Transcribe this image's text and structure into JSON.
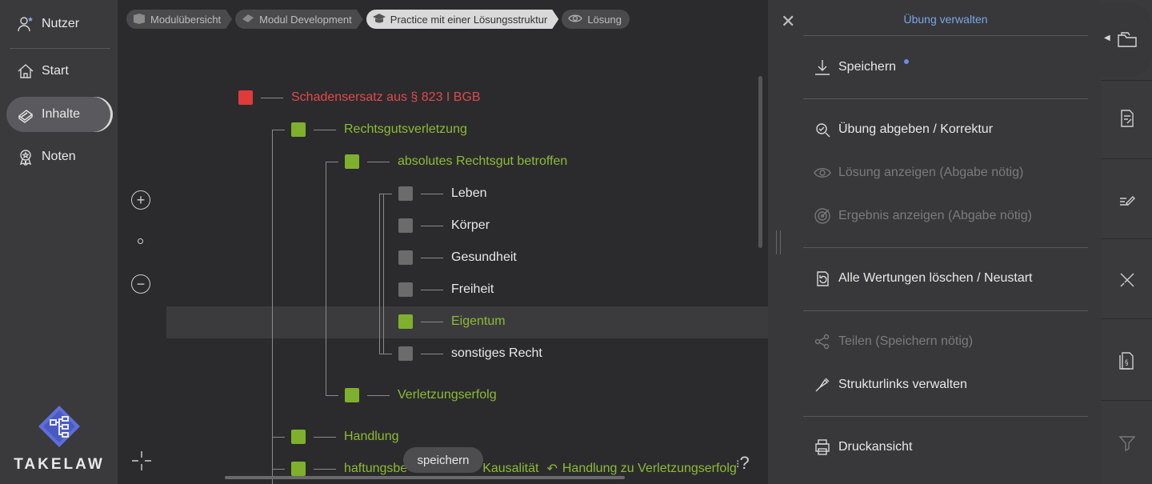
{
  "sidebar": {
    "items": [
      {
        "label": "Nutzer",
        "icon": "user-star-icon"
      },
      {
        "label": "Start",
        "icon": "home-icon"
      },
      {
        "label": "Inhalte",
        "icon": "book-icon"
      },
      {
        "label": "Noten",
        "icon": "award-icon"
      }
    ],
    "logo_text": "TAKELAW"
  },
  "breadcrumb": [
    {
      "label": "Modulübersicht",
      "icon": "box-icon"
    },
    {
      "label": "Modul Development",
      "icon": "book-icon"
    },
    {
      "label": "Practice mit einer Lösungsstruktur",
      "icon": "graduation-cap-icon"
    },
    {
      "label": "Lösung",
      "icon": "eye-icon"
    }
  ],
  "tree": {
    "root": "Schadensersatz aus § 823 I BGB",
    "rechtsgut": "Rechtsgutsverletzung",
    "absolut": "absolutes Rechtsgut betroffen",
    "leaves": [
      "Leben",
      "Körper",
      "Gesundheit",
      "Freiheit",
      "Eigentum",
      "sonstiges Recht"
    ],
    "erfolg": "Verletzungserfolg",
    "handlung": "Handlung",
    "kausal_left": "haftungsbe",
    "kausal_right": "Kausalität",
    "link_text": "Handlung zu Verletzungserfolg"
  },
  "canvas": {
    "save_label": "speichern",
    "help_label": "?"
  },
  "panel": {
    "title": "Übung verwalten",
    "items": [
      {
        "label": "Speichern",
        "icon": "download-icon",
        "disabled": false
      },
      {
        "label": "Übung abgeben / Korrektur",
        "icon": "inspect-icon",
        "disabled": false
      },
      {
        "label": "Lösung anzeigen (Abgabe nötig)",
        "icon": "eye-icon",
        "disabled": true
      },
      {
        "label": "Ergebnis anzeigen (Abgabe nötig)",
        "icon": "target-icon",
        "disabled": true
      },
      {
        "label": "Alle Wertungen löschen / Neustart",
        "icon": "restart-icon",
        "disabled": false
      },
      {
        "label": "Teilen (Speichern nötig)",
        "icon": "share-icon",
        "disabled": true
      },
      {
        "label": "Strukturlinks verwalten",
        "icon": "link-tool-icon",
        "disabled": false
      },
      {
        "label": "Druckansicht",
        "icon": "printer-icon",
        "disabled": false
      }
    ]
  },
  "colors": {
    "accent_blue": "#7aa7e6",
    "node_red": "#e03a3a",
    "node_green": "#7fb02d",
    "node_gray": "#6b6b6b"
  }
}
